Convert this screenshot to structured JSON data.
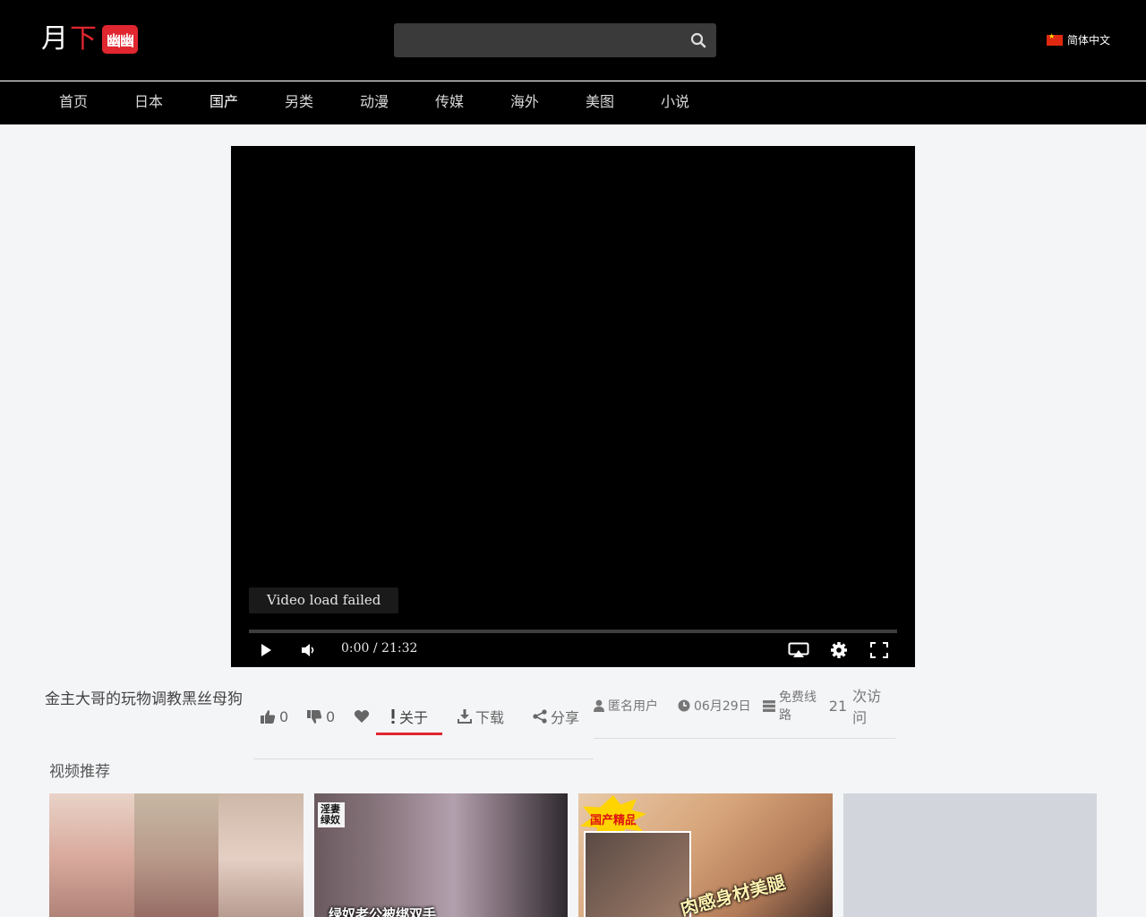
{
  "logo": {
    "part1": "月",
    "part2": "下",
    "badge": "幽幽"
  },
  "search": {
    "placeholder": "",
    "value": ""
  },
  "language": {
    "label": "简体中文",
    "flag_icon": "china-flag-icon"
  },
  "nav": {
    "items": [
      {
        "label": "首页",
        "active": false
      },
      {
        "label": "日本",
        "active": false
      },
      {
        "label": "国产",
        "active": true
      },
      {
        "label": "另类",
        "active": false
      },
      {
        "label": "动漫",
        "active": false
      },
      {
        "label": "传媒",
        "active": false
      },
      {
        "label": "海外",
        "active": false
      },
      {
        "label": "美图",
        "active": false
      },
      {
        "label": "小说",
        "active": false
      }
    ]
  },
  "player": {
    "error": "Video load failed",
    "current_time": "0:00",
    "duration": "21:32",
    "time_display": "0:00 / 21:32",
    "progress": 0
  },
  "video": {
    "title": "金主大哥的玩物调教黑丝母狗",
    "likes": "0",
    "dislikes": "0"
  },
  "tabs": {
    "about": "关于",
    "download": "下载",
    "share": "分享",
    "active": "about"
  },
  "meta": {
    "user": "匿名用户",
    "date": "06月29日",
    "line": "免费线路",
    "visits_count": "21",
    "visits_label": "次访问"
  },
  "recommend": {
    "title": "视频推荐",
    "cards": [
      {
        "kind": "thumbnail"
      },
      {
        "kind": "thumbnail",
        "tag": "淫妻绿奴",
        "caption": "绿奴老公被绑双手"
      },
      {
        "kind": "thumbnail",
        "badge": "国产精品",
        "caption": "肉感身材美腿"
      },
      {
        "kind": "placeholder"
      }
    ]
  },
  "colors": {
    "accent": "#e0262f",
    "header_bg": "#000000",
    "page_bg": "#f4f5f7"
  }
}
